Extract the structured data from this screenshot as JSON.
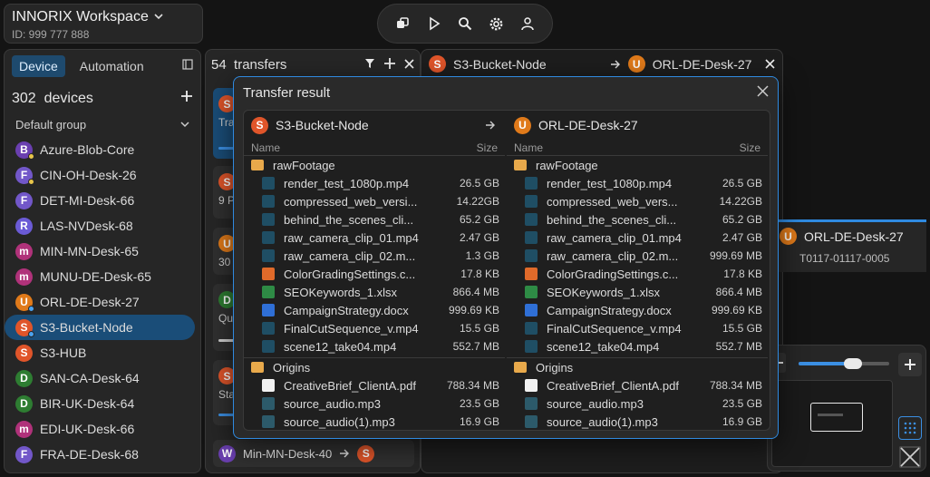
{
  "workspace": {
    "title": "INNORIX Workspace",
    "id": "ID: 999 777 888"
  },
  "sidebar": {
    "tabs": [
      "Device",
      "Automation"
    ],
    "count": "302",
    "count_label": "devices",
    "group": "Default group",
    "devices": [
      {
        "initial": "B",
        "color": "#6a3fb0",
        "dot": "#e8c54a",
        "name": "Azure-Blob-Core"
      },
      {
        "initial": "F",
        "color": "#7257c9",
        "dot": "#e8c54a",
        "name": "CIN-OH-Desk-26"
      },
      {
        "initial": "F",
        "color": "#7257c9",
        "dot": "",
        "name": "DET-MI-Desk-66"
      },
      {
        "initial": "R",
        "color": "#6b5bd6",
        "dot": "",
        "name": "LAS-NVDesk-68"
      },
      {
        "initial": "m",
        "color": "#b0327a",
        "dot": "",
        "name": "MIN-MN-Desk-65"
      },
      {
        "initial": "m",
        "color": "#b0327a",
        "dot": "",
        "name": "MUNU-DE-Desk-65"
      },
      {
        "initial": "U",
        "color": "#e07a1a",
        "dot": "#4aa3f0",
        "name": "ORL-DE-Desk-27"
      },
      {
        "initial": "S",
        "color": "#e0552a",
        "dot": "#4aa3f0",
        "name": "S3-Bucket-Node"
      },
      {
        "initial": "S",
        "color": "#e0552a",
        "dot": "",
        "name": "S3-HUB"
      },
      {
        "initial": "D",
        "color": "#2e7d32",
        "dot": "",
        "name": "SAN-CA-Desk-64"
      },
      {
        "initial": "D",
        "color": "#2e7d32",
        "dot": "",
        "name": "BIR-UK-Desk-64"
      },
      {
        "initial": "m",
        "color": "#b0327a",
        "dot": "",
        "name": "EDI-UK-Desk-66"
      },
      {
        "initial": "F",
        "color": "#7257c9",
        "dot": "",
        "name": "FRA-DE-Desk-68"
      }
    ]
  },
  "transfers": {
    "count": "54",
    "label": "transfers",
    "cards": [
      {
        "initial": "S",
        "color": "#e0552a",
        "text": "Tra"
      },
      {
        "initial": "S",
        "color": "#e0552a",
        "text": "9 P"
      },
      {
        "initial": "U",
        "color": "#e07a1a",
        "text": "30"
      },
      {
        "initial": "D",
        "color": "#2e7d32",
        "text": "Qu"
      },
      {
        "initial": "S",
        "color": "#e0552a",
        "text": "Sta"
      }
    ],
    "bottom": {
      "initial": "W",
      "color": "#6a3fb0",
      "name": "Min-MN-Desk-40",
      "target_initial": "S",
      "target_color": "#e0552a"
    }
  },
  "detail_header": {
    "src_initial": "S",
    "src_color": "#e0552a",
    "src": "S3-Bucket-Node",
    "dst_initial": "U",
    "dst_color": "#e07a1a",
    "dst": "ORL-DE-Desk-27"
  },
  "rightcard": {
    "initial": "U",
    "color": "#e07a1a",
    "name": "ORL-DE-Desk-27",
    "code": "T0117-01117-0005"
  },
  "modal": {
    "title": "Transfer result",
    "source": {
      "initial": "S",
      "color": "#e0552a",
      "name": "S3-Bucket-Node"
    },
    "target": {
      "initial": "U",
      "color": "#e07a1a",
      "name": "ORL-DE-Desk-27"
    },
    "col_name": "Name",
    "col_size": "Size",
    "left": [
      {
        "type": "folder",
        "name": "rawFootage",
        "size": ""
      },
      {
        "type": "video",
        "name": "render_test_1080p.mp4",
        "size": "26.5 GB"
      },
      {
        "type": "video",
        "name": "compressed_web_versi...",
        "size": "14.22GB"
      },
      {
        "type": "video",
        "name": "behind_the_scenes_cli...",
        "size": "65.2 GB"
      },
      {
        "type": "video",
        "name": "raw_camera_clip_01.mp4",
        "size": "2.47 GB"
      },
      {
        "type": "video",
        "name": "raw_camera_clip_02.m...",
        "size": "1.3 GB"
      },
      {
        "type": "settings",
        "name": "ColorGradingSettings.c...",
        "size": "17.8 KB"
      },
      {
        "type": "xlsx",
        "name": "SEOKeywords_1.xlsx",
        "size": "866.4 MB"
      },
      {
        "type": "docx",
        "name": "CampaignStrategy.docx",
        "size": "999.69 KB"
      },
      {
        "type": "video",
        "name": "FinalCutSequence_v.mp4",
        "size": "15.5 GB"
      },
      {
        "type": "video",
        "name": "scene12_take04.mp4",
        "size": "552.7 MB"
      },
      {
        "type": "folder",
        "name": "Origins",
        "size": ""
      },
      {
        "type": "pdf",
        "name": "CreativeBrief_ClientA.pdf",
        "size": "788.34 MB"
      },
      {
        "type": "audio",
        "name": "source_audio.mp3",
        "size": "23.5 GB"
      },
      {
        "type": "audio",
        "name": "source_audio(1).mp3",
        "size": "16.9 GB"
      }
    ],
    "right": [
      {
        "type": "folder",
        "name": "rawFootage",
        "size": ""
      },
      {
        "type": "video",
        "name": "render_test_1080p.mp4",
        "size": "26.5 GB"
      },
      {
        "type": "video",
        "name": "compressed_web_vers...",
        "size": "14.22GB"
      },
      {
        "type": "video",
        "name": "behind_the_scenes_cli...",
        "size": "65.2 GB"
      },
      {
        "type": "video",
        "name": "raw_camera_clip_01.mp4",
        "size": "2.47 GB"
      },
      {
        "type": "video",
        "name": "raw_camera_clip_02.m...",
        "size": "999.69 MB"
      },
      {
        "type": "settings",
        "name": "ColorGradingSettings.c...",
        "size": "17.8 KB"
      },
      {
        "type": "xlsx",
        "name": "SEOKeywords_1.xlsx",
        "size": "866.4 MB"
      },
      {
        "type": "docx",
        "name": "CampaignStrategy.docx",
        "size": "999.69 KB"
      },
      {
        "type": "video",
        "name": "FinalCutSequence_v.mp4",
        "size": "15.5 GB"
      },
      {
        "type": "video",
        "name": "scene12_take04.mp4",
        "size": "552.7 MB"
      },
      {
        "type": "folder",
        "name": "Origins",
        "size": ""
      },
      {
        "type": "pdf",
        "name": "CreativeBrief_ClientA.pdf",
        "size": "788.34 MB"
      },
      {
        "type": "audio",
        "name": "source_audio.mp3",
        "size": "23.5 GB"
      },
      {
        "type": "audio",
        "name": "source_audio(1).mp3",
        "size": "16.9 GB"
      }
    ]
  },
  "zoom": {
    "level": 0.6
  }
}
